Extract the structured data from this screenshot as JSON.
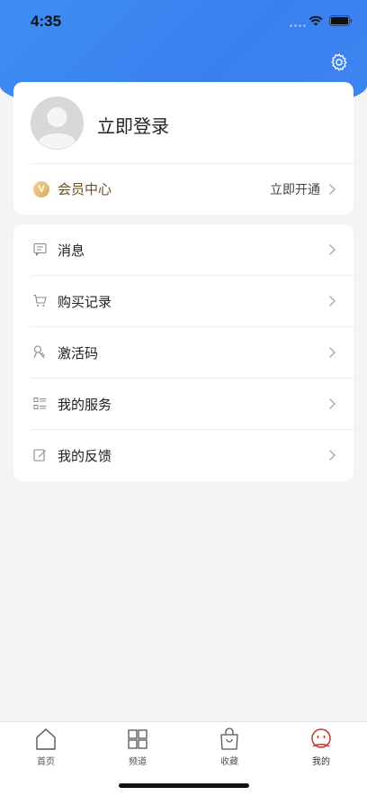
{
  "status_bar": {
    "time": "4:35"
  },
  "profile": {
    "login_label": "立即登录"
  },
  "vip": {
    "badge": "V",
    "label": "会员中心",
    "action": "立即开通"
  },
  "menu": {
    "items": [
      {
        "label": "消息",
        "icon": "message-icon"
      },
      {
        "label": "购买记录",
        "icon": "cart-icon"
      },
      {
        "label": "激活码",
        "icon": "key-icon"
      },
      {
        "label": "我的服务",
        "icon": "service-list-icon"
      },
      {
        "label": "我的反馈",
        "icon": "feedback-icon"
      }
    ]
  },
  "tabbar": {
    "tabs": [
      {
        "label": "首页",
        "icon": "home-icon"
      },
      {
        "label": "频道",
        "icon": "grid-icon"
      },
      {
        "label": "收藏",
        "icon": "bag-icon"
      },
      {
        "label": "我的",
        "icon": "profile-face-icon",
        "active": true
      }
    ]
  },
  "colors": {
    "header": "#3a7ff0",
    "vip_text": "#6b4e1f",
    "active_tab": "#c0392b"
  }
}
